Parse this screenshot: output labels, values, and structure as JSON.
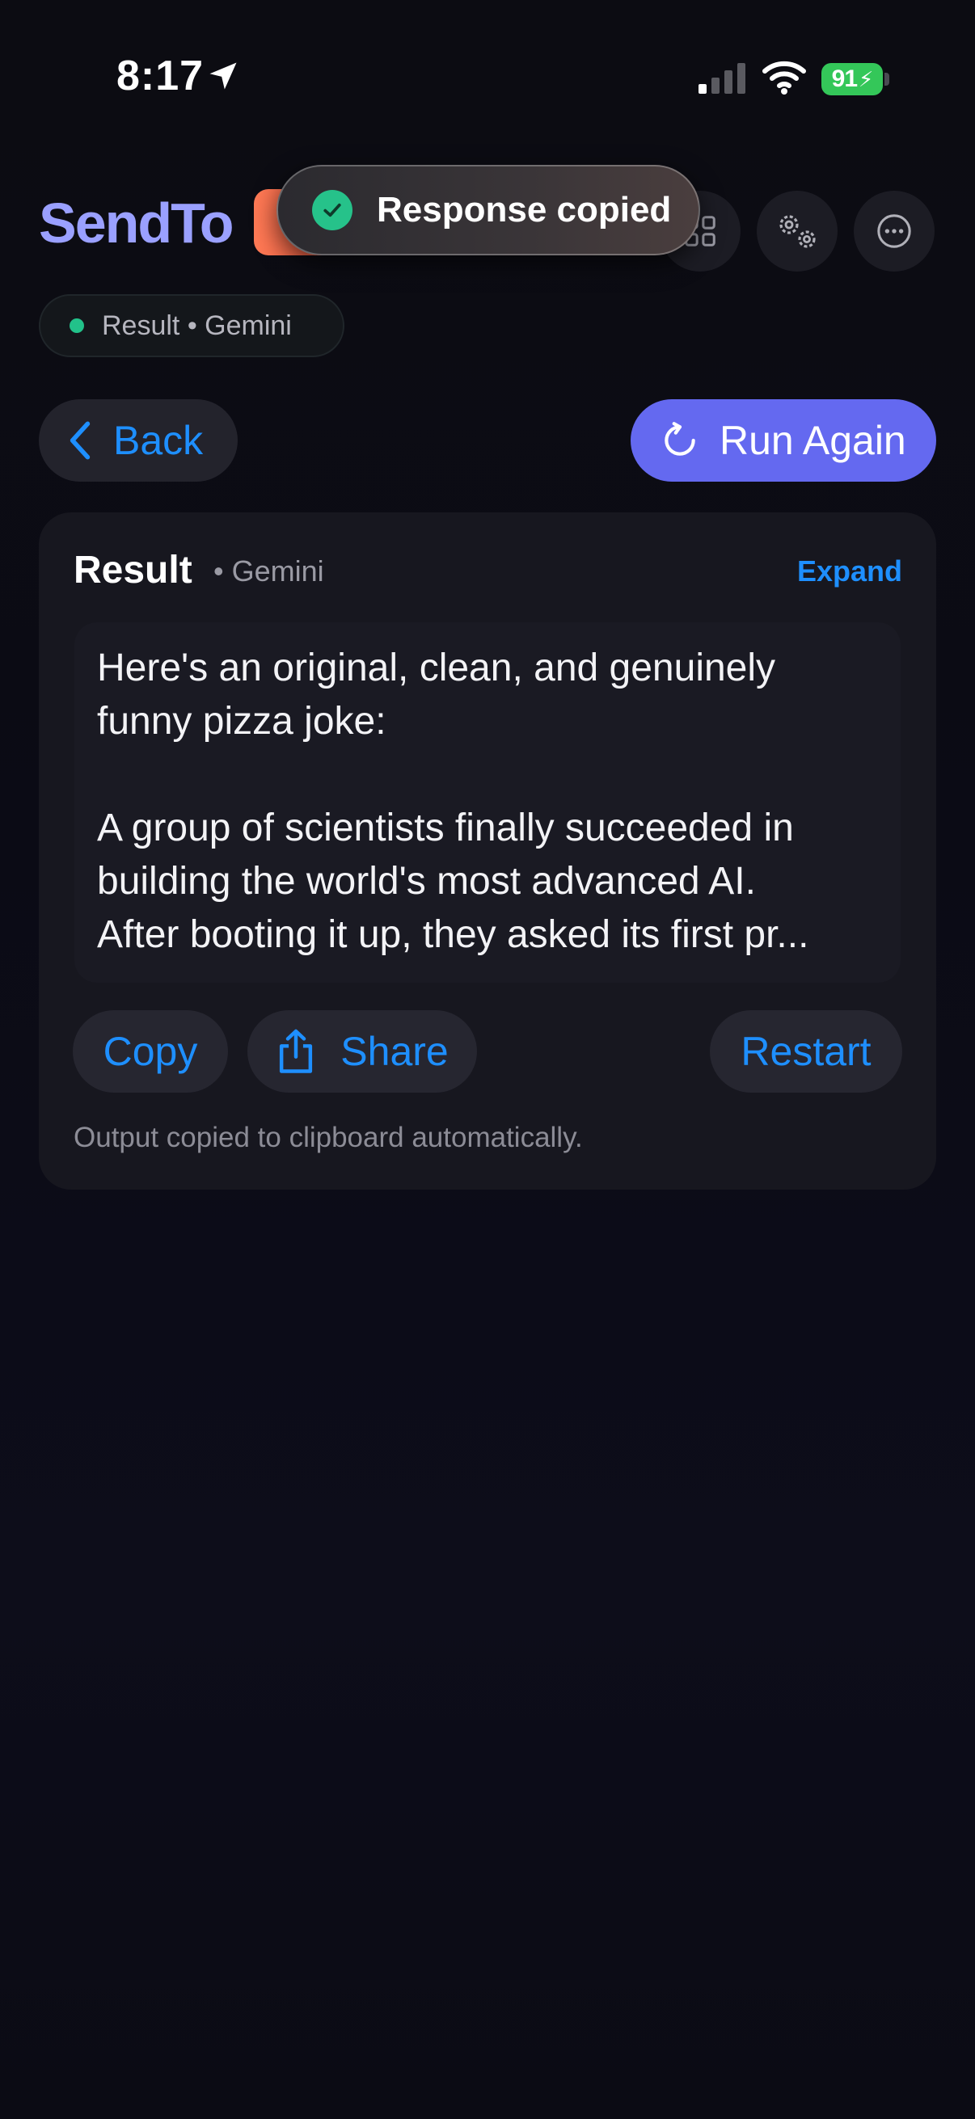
{
  "status_bar": {
    "time": "8:17",
    "battery": "91",
    "icons": [
      "location-arrow-icon",
      "signal-icon",
      "wifi-icon",
      "battery-icon"
    ]
  },
  "header": {
    "brand": "SendTo",
    "brand_color": "#9aa0ff",
    "buttons": [
      "grid-icon",
      "settings-gears-icon",
      "more-icon"
    ]
  },
  "toast": {
    "message": "Response copied"
  },
  "status_pill": {
    "label": "Result",
    "separator": "•",
    "source": "Gemini",
    "text": "Result • Gemini"
  },
  "nav": {
    "back_label": "Back",
    "run_again_label": "Run Again"
  },
  "result_card": {
    "title": "Result",
    "source": "• Gemini",
    "expand_label": "Expand",
    "body": "Here's an original, clean, and genuinely\nfunny pizza joke:\n\nA group of scientists finally succeeded in\nbuilding the world's most advanced AI.\nAfter booting it up, they asked its first pr...",
    "copy_label": "Copy",
    "share_label": "Share",
    "restart_label": "Restart",
    "footnote": "Output copied to clipboard automatically."
  },
  "colors": {
    "accent_blue": "#1e8fff",
    "run_again_bg": "#6469f0",
    "success_green": "#22c28a",
    "background": "#0c0c12"
  }
}
